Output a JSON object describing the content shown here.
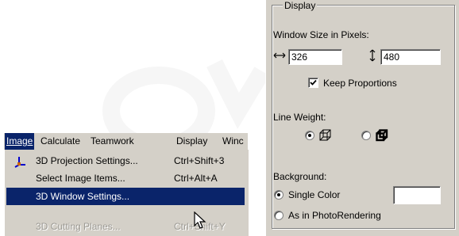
{
  "menu": {
    "bar_items": [
      {
        "label": "Image",
        "active": true
      },
      {
        "label": "Calculate",
        "active": false
      },
      {
        "label": "Teamwork",
        "active": false
      },
      {
        "label": "Display",
        "active": false
      },
      {
        "label": "Winc",
        "active": false
      }
    ],
    "dropdown_items": [
      {
        "label": "3D Projection Settings...",
        "shortcut": "Ctrl+Shift+3",
        "state": "normal",
        "icon": "projection-icon"
      },
      {
        "label": "Select Image Items...",
        "shortcut": "Ctrl+Alt+A",
        "state": "normal"
      },
      {
        "label": "3D Window Settings...",
        "shortcut": "",
        "state": "highlighted"
      },
      {
        "label": "3D Cutting Planes...",
        "shortcut": "Ctrl+Shift+Y",
        "state": "disabled"
      }
    ],
    "highlight_color": "#0a246a"
  },
  "dialog": {
    "group_label": "Display",
    "window_size_label": "Window Size in Pixels:",
    "width_value": "326",
    "height_value": "480",
    "keep_proportions_label": "Keep Proportions",
    "keep_proportions_checked": true,
    "line_weight_label": "Line Weight:",
    "line_weight_options": [
      {
        "icon": "thin-cube-icon",
        "selected": true
      },
      {
        "icon": "thick-cube-icon",
        "selected": false
      }
    ],
    "background_label": "Background:",
    "background_options": [
      {
        "label": "Single Color",
        "selected": true
      },
      {
        "label": "As in PhotoRendering",
        "selected": false
      }
    ],
    "background_swatch_color": "#ffffff"
  },
  "colors": {
    "face": "#d4d0c8",
    "shadow": "#808080"
  }
}
